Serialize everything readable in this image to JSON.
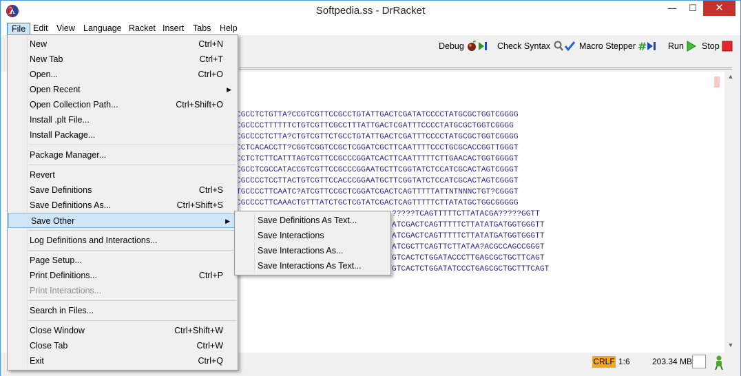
{
  "window": {
    "title": "Softpedia.ss - DrRacket",
    "minimize": "—",
    "maximize": "☐",
    "close": "✕"
  },
  "menubar": [
    "File",
    "Edit",
    "View",
    "Language",
    "Racket",
    "Insert",
    "Tabs",
    "Help"
  ],
  "toolbar": {
    "debug": "Debug",
    "check_syntax": "Check Syntax",
    "macro_stepper": "Macro Stepper",
    "run": "Run",
    "stop": "Stop"
  },
  "file_menu": [
    {
      "label": "New",
      "shortcut": "Ctrl+N"
    },
    {
      "label": "New Tab",
      "shortcut": "Ctrl+T"
    },
    {
      "label": "Open...",
      "shortcut": "Ctrl+O"
    },
    {
      "label": "Open Recent",
      "submenu": true
    },
    {
      "label": "Open Collection Path...",
      "shortcut": "Ctrl+Shift+O"
    },
    {
      "label": "Install .plt File..."
    },
    {
      "label": "Install Package..."
    },
    {
      "label": "Package Manager..."
    },
    {
      "label": "Revert"
    },
    {
      "label": "Save Definitions",
      "shortcut": "Ctrl+S"
    },
    {
      "label": "Save Definitions As...",
      "shortcut": "Ctrl+Shift+S"
    },
    {
      "label": "Save Other",
      "submenu": true,
      "highlighted": true
    },
    {
      "label": "Log Definitions and Interactions..."
    },
    {
      "label": "Page Setup..."
    },
    {
      "label": "Print Definitions...",
      "shortcut": "Ctrl+P"
    },
    {
      "label": "Print Interactions...",
      "disabled": true
    },
    {
      "label": "Search in Files..."
    },
    {
      "label": "Close Window",
      "shortcut": "Ctrl+Shift+W"
    },
    {
      "label": "Close Tab",
      "shortcut": "Ctrl+W"
    },
    {
      "label": "Exit",
      "shortcut": "Ctrl+Q"
    }
  ],
  "save_other_menu": [
    "Save Definitions As Text...",
    "Save Interactions",
    "Save Interactions As...",
    "Save Interactions As Text..."
  ],
  "editor_lines": [
    "CGCCTCTGTTA?CCGTCGTTCCGCCTGTATTGACTCGATATCCCCTATGCGCTGGTCGGGG",
    "CGCCCCTTTTTTCTGTCGTTCGCCTTTATTGACTCGATTTCCCCTATGCGCTGGTCGGGG",
    "CGCCCCTCTTA?CTGTCGTTCTGCCTGTATTGACTCGATTTCCCCTATGCGCTGGTCGGGG",
    "CCTCACACCTT?CGGTCGGTCCGCTCGGATCGCTTCAATTTTCCCTGCGCACCGGTTGGGT",
    "CCTCTCTTCATTTAGTCGTTCCGCCCGGATCACTTCAATTTTTCTTGAACACTGGTGGGGT",
    "CGCCTCGCCATACCGTCGTTCCGCCCGGAATGCTTCGGTATCTCCATCGCACTAGTCGGGT",
    "CGCCCCTCCTTACTGTCGTTCCACCCGGAATGCTTCGGTATCTCCATCGCACTAGTCGGGT",
    "TGCCCCTTCAATC?ATCGTTCCGCTCGGATCGACTCAGTTTTTATTNTNNNCTGT?CGGGT",
    "CGCCCCTTCAAACTGTTTATCTGCTCGTATCGACTCAGTTTTTCTTATATGCTGGCGGGGG",
    "?????TCAGTTTTTCTTATACGA?????GGTT",
    "ATCGACTCAGTTTTTCTTATATGATGGTGGGTT",
    "ATCGACTCAGTTTTTCTTATATGATGGTGGGTT",
    "ATCGCTTCAGTTCTTATAA?ACGCCAGCCGGGT",
    "GTCACTCTGGATACCCTTGAGCGCTGCTTCAGT",
    "GTCACTCTGGATATCCCTGAGCGCTGCTTTCAGT"
  ],
  "status": {
    "eol": "CRLF",
    "position": "1:6",
    "memory": "203.34 MB"
  },
  "colors": {
    "code_text": "#2c2a9a",
    "crlf_bg": "#f5a623",
    "menu_highlight": "#cde6fa",
    "close_btn": "#c7312b"
  }
}
